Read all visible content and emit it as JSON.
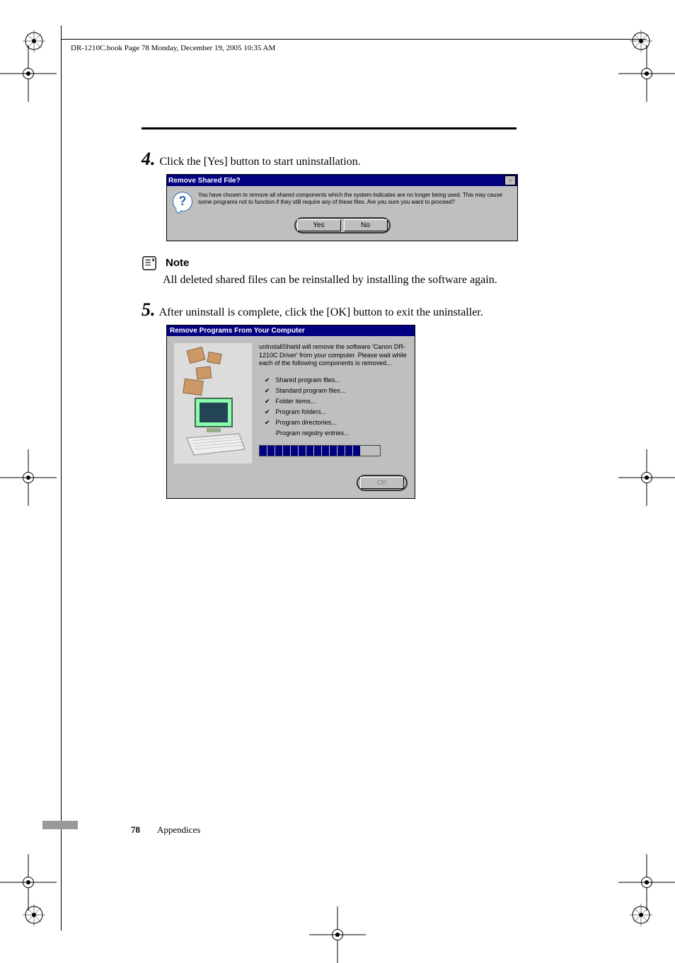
{
  "header": {
    "running_head": "DR-1210C.book  Page 78  Monday, December 19, 2005  10:35 AM"
  },
  "steps": {
    "four": {
      "num": "4.",
      "text": "Click the [Yes] button to start uninstallation."
    },
    "five": {
      "num": "5.",
      "text": "After uninstall is complete, click the [OK] button to exit the uninstaller."
    }
  },
  "note": {
    "label": "Note",
    "text": "All deleted shared files can be reinstalled by installing the software again."
  },
  "dialog1": {
    "title": "Remove Shared File?",
    "message": "You have chosen to remove all shared components which the system indicates are no longer being used.  This may cause some programs not to function if they still require any of these files.  Are you sure you want to proceed?",
    "yes": "Yes",
    "no": "No"
  },
  "dialog2": {
    "title": "Remove Programs From Your Computer",
    "message": "unInstallShield will remove the software 'Canon DR-1210C Driver' from your computer.  Please wait while each of the following components is removed...",
    "items": {
      "a": "Shared program files...",
      "b": "Standard program files...",
      "c": "Folder items...",
      "d": "Program folders...",
      "e": "Program directories...",
      "f": "Program registry entries..."
    },
    "ok": "OK"
  },
  "footer": {
    "page": "78",
    "section": "Appendices"
  }
}
